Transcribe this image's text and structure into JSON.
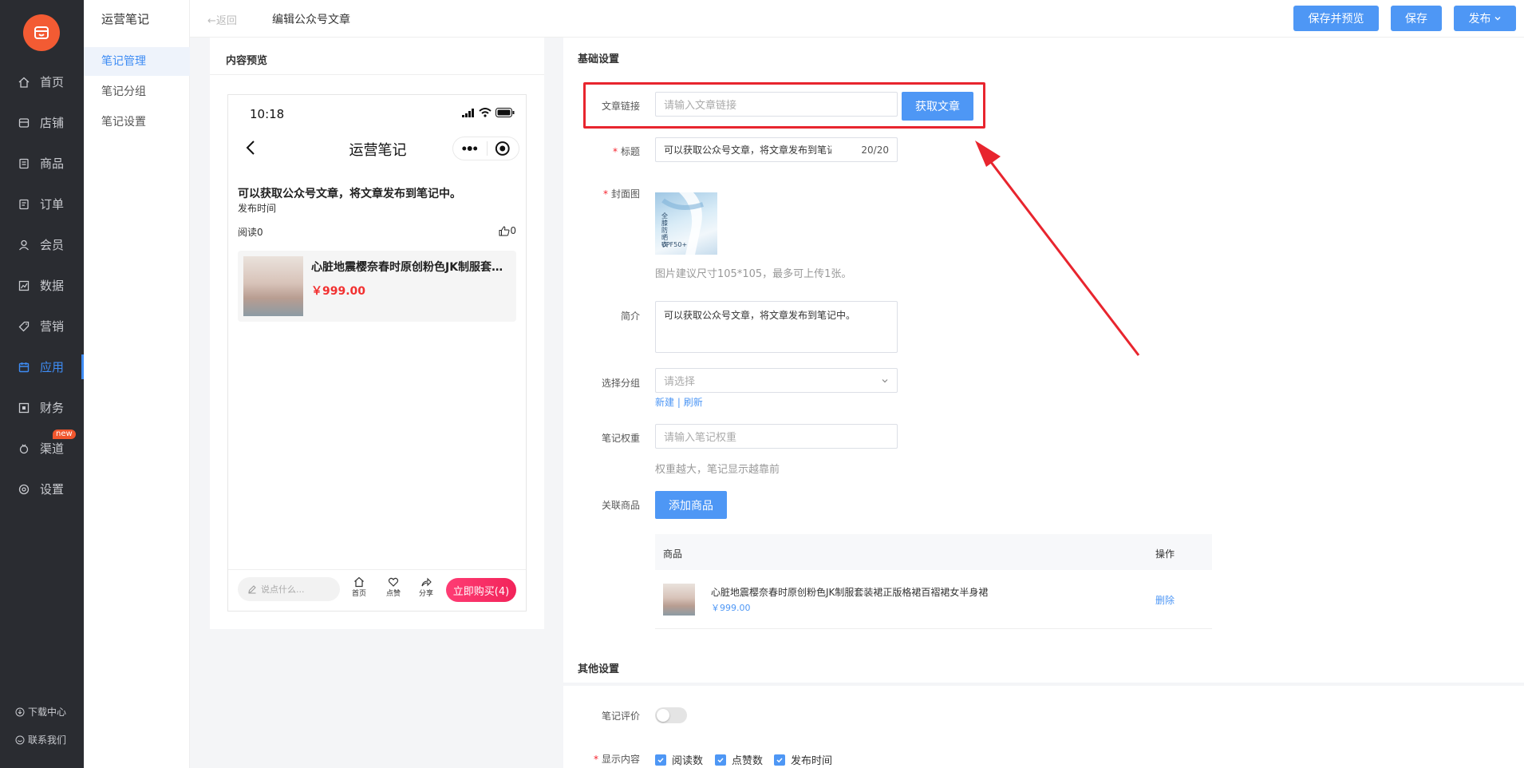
{
  "sidebar": {
    "items": [
      {
        "label": "首页",
        "icon": "home-icon"
      },
      {
        "label": "店铺",
        "icon": "shop-icon"
      },
      {
        "label": "商品",
        "icon": "goods-icon"
      },
      {
        "label": "订单",
        "icon": "order-icon"
      },
      {
        "label": "会员",
        "icon": "member-icon"
      },
      {
        "label": "数据",
        "icon": "chart-icon"
      },
      {
        "label": "营销",
        "icon": "tag-icon"
      },
      {
        "label": "应用",
        "icon": "app-icon"
      },
      {
        "label": "财务",
        "icon": "finance-icon"
      },
      {
        "label": "渠道",
        "icon": "channel-icon"
      },
      {
        "label": "设置",
        "icon": "gear-icon"
      }
    ],
    "active_index": 7,
    "new_badge": "new",
    "download": "下载中心",
    "contact": "联系我们"
  },
  "subnav": {
    "title": "运营笔记",
    "items": [
      {
        "label": "笔记管理"
      },
      {
        "label": "笔记分组"
      },
      {
        "label": "笔记设置"
      }
    ]
  },
  "topbar": {
    "back": "←返回",
    "title": "编辑公众号文章",
    "save_preview": "保存并预览",
    "save": "保存",
    "publish": "发布"
  },
  "preview": {
    "heading": "内容预览",
    "phone": {
      "time": "10:18",
      "nav_title": "运营笔记",
      "article_title": "可以获取公众号文章，将文章发布到笔记中。",
      "publish_time": "发布时间",
      "read": "阅读0",
      "likes": "0",
      "product_name": "心脏地震樱奈春时原创粉色JK制服套装裙正版格裙百褶裙女半身裙",
      "product_price": "￥999.00",
      "comment_placeholder": "说点什么...",
      "home": "首页",
      "like": "点赞",
      "share": "分享",
      "buy": "立即购买(4)"
    }
  },
  "form": {
    "basic_title": "基础设置",
    "link_label": "文章链接",
    "link_placeholder": "请输入文章链接",
    "fetch_btn": "获取文章",
    "title_label": "标题",
    "title_value": "可以获取公众号文章，将文章发布到笔记中。",
    "title_count": "20/20",
    "cover_label": "封面图",
    "cover_text_1": "UPF50+",
    "cover_text_2": "全膝防晒衣",
    "cover_hint": "图片建议尺寸105*105，最多可上传1张。",
    "summary_label": "简介",
    "summary_value": "可以获取公众号文章，将文章发布到笔记中。",
    "group_label": "选择分组",
    "group_placeholder": "请选择",
    "group_new": "新建",
    "group_sep": "|",
    "group_refresh": "刷新",
    "weight_label": "笔记权重",
    "weight_placeholder": "请输入笔记权重",
    "weight_hint": "权重越大，笔记显示越靠前",
    "product_label": "关联商品",
    "add_product": "添加商品",
    "table_col_product": "商品",
    "table_col_action": "操作",
    "table_rows": [
      {
        "name": "心脏地震樱奈春时原创粉色JK制服套装裙正版格裙百褶裙女半身裙",
        "price": "￥999.00",
        "action": "删除"
      }
    ],
    "other_title": "其他设置",
    "review_label": "笔记评价",
    "review_on": false,
    "display_label": "显示内容",
    "display_options": [
      {
        "label": "阅读数",
        "checked": true
      },
      {
        "label": "点赞数",
        "checked": true
      },
      {
        "label": "发布时间",
        "checked": true
      }
    ]
  },
  "colors": {
    "accent": "#4e97f5",
    "brand": "#f35b33",
    "highlight": "#e8252e",
    "price": "#f23030"
  }
}
